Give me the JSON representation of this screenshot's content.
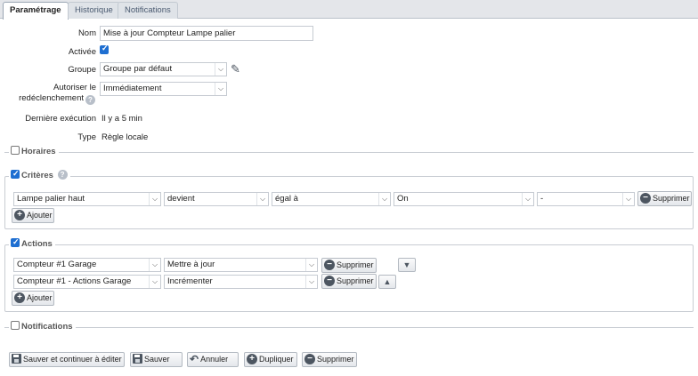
{
  "tabs": [
    "Paramétrage",
    "Historique",
    "Notifications"
  ],
  "form": {
    "nom_label": "Nom",
    "nom_value": "Mise à jour Compteur Lampe palier",
    "activee_label": "Activée",
    "groupe_label": "Groupe",
    "groupe_value": "Groupe par défaut",
    "redecl_label_line1": "Autoriser le",
    "redecl_label_line2": "redéclenchement",
    "redecl_value": "Immédiatement",
    "derniere_label": "Dernière exécution",
    "derniere_value": "Il y a 5 min",
    "type_label": "Type",
    "type_value": "Règle locale"
  },
  "sections": {
    "horaires": "Horaires",
    "criteres": "Critères",
    "actions": "Actions",
    "notifications": "Notifications"
  },
  "criteria": {
    "device": "Lampe palier haut",
    "event": "devient",
    "operator": "égal à",
    "value": "On",
    "extra": "-",
    "delete_label": "Supprimer",
    "add_label": "Ajouter"
  },
  "actions": {
    "rows": [
      {
        "device": "Compteur #1 Garage",
        "action": "Mettre à jour",
        "delete_label": "Supprimer"
      },
      {
        "device": "Compteur #1 - Actions Garage",
        "action": "Incrémenter",
        "delete_label": "Supprimer"
      }
    ],
    "add_label": "Ajouter"
  },
  "footer": {
    "save_continue": "Sauver et continuer à éditer",
    "save": "Sauver",
    "cancel": "Annuler",
    "duplicate": "Dupliquer",
    "delete": "Supprimer"
  },
  "icons": {
    "help": "question-icon",
    "add": "plus-circle-icon",
    "remove": "minus-circle-icon",
    "save": "floppy-icon",
    "undo": "undo-icon",
    "edit": "pencil-icon",
    "move_down": "triangle-down-icon",
    "move_up": "triangle-up-icon"
  },
  "colors": {
    "tabbar_bg": "#e4e6ea",
    "checkbox_checked": "#1f6fd1",
    "icon_dark": "#4d5661",
    "border": "#c8ccd2"
  }
}
